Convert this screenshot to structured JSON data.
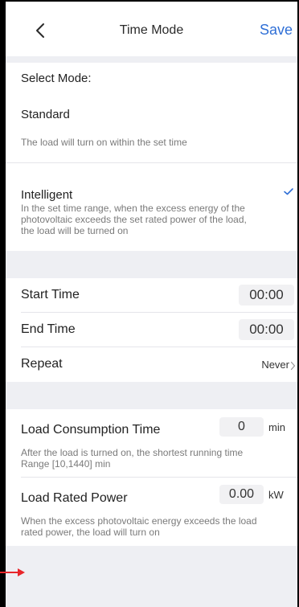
{
  "nav": {
    "back_icon": "chevron-left-icon",
    "title": "Time Mode",
    "save_label": "Save"
  },
  "mode": {
    "heading": "Select Mode:",
    "standard": {
      "title": "Standard",
      "description": "The load will turn on within the set time"
    },
    "intelligent": {
      "title": "Intelligent",
      "description_line1": "In the set time range, when the excess energy of the",
      "description_line2": "photovoltaic exceeds the set rated power of the load,",
      "description_line3": "the load will be turned on",
      "selected": true,
      "check_icon": "checkmark-icon"
    }
  },
  "schedule": {
    "start_label": "Start Time",
    "start_value": "00:00",
    "end_label": "End Time",
    "end_value": "00:00",
    "repeat_label": "Repeat",
    "repeat_value": "Never",
    "repeat_icon": "chevron-right-icon"
  },
  "load": {
    "consumption_label": "Load Consumption Time",
    "consumption_value": "0",
    "consumption_unit": "min",
    "consumption_desc_line1": "After the load is turned on, the shortest running time",
    "consumption_desc_line2": "Range [10,1440] min",
    "power_label": "Load Rated Power",
    "power_value": "0.00",
    "power_unit": "kW",
    "power_desc_line1": "When the excess photovoltaic energy exceeds the load",
    "power_desc_line2": "rated power, the load will turn on"
  },
  "colors": {
    "accent": "#2f6fd6",
    "background_gap": "#eeeff3",
    "annotation_arrow": "#e8262a"
  }
}
